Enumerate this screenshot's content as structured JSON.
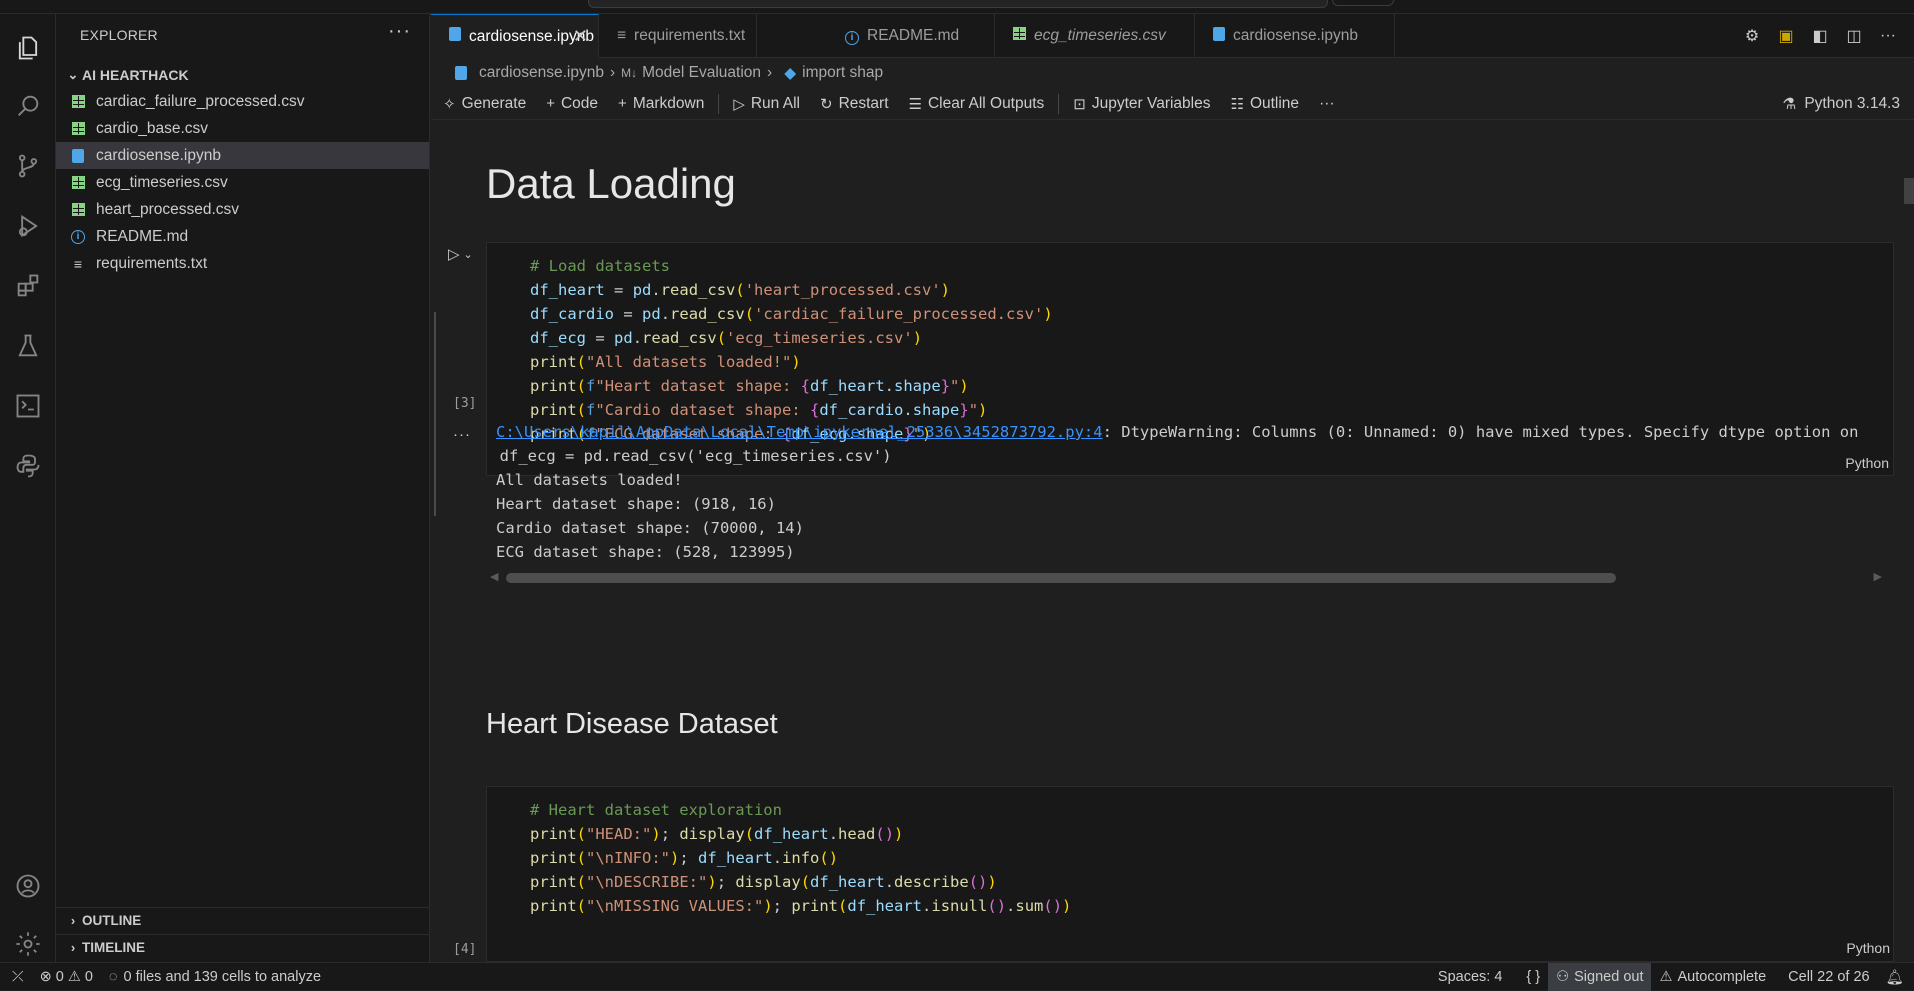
{
  "sidebar": {
    "title": "EXPLORER",
    "folder": "AI HEARTHACK",
    "files": [
      {
        "name": "cardiac_failure_processed.csv",
        "type": "csv"
      },
      {
        "name": "cardio_base.csv",
        "type": "csv"
      },
      {
        "name": "cardiosense.ipynb",
        "type": "notebook",
        "selected": true
      },
      {
        "name": "ecg_timeseries.csv",
        "type": "csv"
      },
      {
        "name": "heart_processed.csv",
        "type": "csv"
      },
      {
        "name": "README.md",
        "type": "info"
      },
      {
        "name": "requirements.txt",
        "type": "text"
      }
    ],
    "outline": "OUTLINE",
    "timeline": "TIMELINE"
  },
  "tabs": [
    {
      "label": "cardiosense.ipynb",
      "active": true
    },
    {
      "label": "requirements.txt"
    },
    {
      "label": "README.md"
    },
    {
      "label": "ecg_timeseries.csv",
      "italic": true
    },
    {
      "label": "cardiosense.ipynb"
    }
  ],
  "breadcrumb": {
    "file": "cardiosense.ipynb",
    "section": "Model Evaluation",
    "symbol": "import shap"
  },
  "toolbar": {
    "generate": "Generate",
    "code": "Code",
    "markdown": "Markdown",
    "run_all": "Run All",
    "restart": "Restart",
    "clear_outputs": "Clear All Outputs",
    "variables": "Jupyter Variables",
    "outline": "Outline",
    "kernel": "Python 3.14.3"
  },
  "notebook": {
    "heading1": "Data Loading",
    "heading2": "Heart Disease Dataset",
    "cell1": {
      "exec": "[3]",
      "lang": "Python"
    },
    "cell2": {
      "exec": "[4]",
      "lang": "Python"
    },
    "output": {
      "path": "C:\\Users\\kapil\\AppData\\Local\\Temp\\ipykernel_25336\\3452873792.py:4",
      "warning": ": DtypeWarning: Columns (0: Unnamed: 0) have mixed types. Specify dtype option on",
      "lines": [
        "  df_ecg = pd.read_csv('ecg_timeseries.csv')",
        "All datasets loaded!",
        "Heart dataset shape: (918, 16)",
        "Cardio dataset shape: (70000, 14)",
        "ECG dataset shape: (528, 123995)"
      ]
    }
  },
  "status": {
    "errors": "0",
    "warnings": "0",
    "analyze": "0 files and 139 cells to analyze",
    "spaces": "Spaces: 4",
    "braces": "{ }",
    "signed_out": "Signed out",
    "autocomplete": "Autocomplete",
    "cell": "Cell 22 of 26"
  }
}
